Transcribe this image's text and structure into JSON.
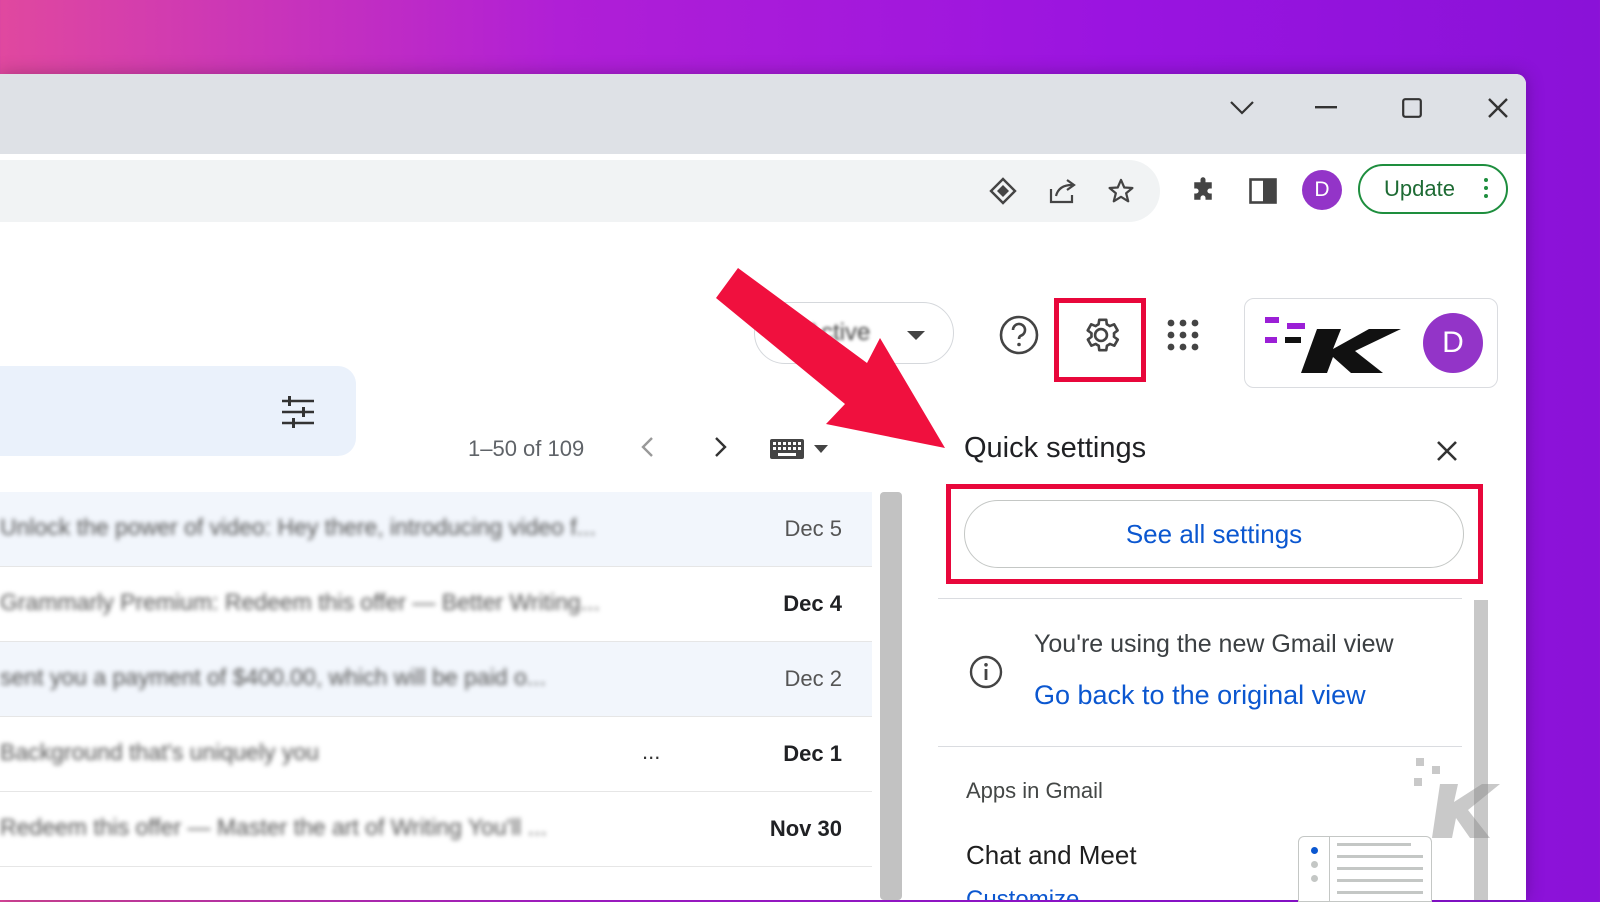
{
  "browser": {
    "profile_initial": "D",
    "update_label": "Update",
    "icons": [
      "caret-down-icon",
      "minimize-icon",
      "maximize-icon",
      "close-icon",
      "password-key-icon",
      "share-icon",
      "star-icon",
      "extensions-icon",
      "side-panel-icon"
    ]
  },
  "gmail": {
    "status_label": "Active",
    "account_initial": "D",
    "pagination": "1–50 of 109"
  },
  "emails": [
    {
      "subject": "Unlock the power of video: Hey there, introducing video f...",
      "date": "Dec 5",
      "unread": false,
      "ellipsis": ""
    },
    {
      "subject": "Grammarly Premium: Redeem this offer — Better Writing...",
      "date": "Dec 4",
      "unread": true,
      "ellipsis": ""
    },
    {
      "subject": "sent you a payment of $400.00, which will be paid o...",
      "date": "Dec 2",
      "unread": false,
      "ellipsis": ""
    },
    {
      "subject": "Background that's uniquely you",
      "date": "Dec 1",
      "unread": true,
      "ellipsis": "..."
    },
    {
      "subject": "Redeem this offer — Master the art of Writing You'll ...",
      "date": "Nov 30",
      "unread": true,
      "ellipsis": ""
    }
  ],
  "quick_settings": {
    "title": "Quick settings",
    "see_all": "See all settings",
    "notice": "You're using the new Gmail view",
    "back_link": "Go back to the original view",
    "apps_heading": "Apps in Gmail",
    "chat_meet": "Chat and Meet",
    "customize": "Customize"
  },
  "colors": {
    "highlight": "#e8073b",
    "accent_link": "#0b57d0",
    "update_green": "#1e8e3e",
    "avatar_purple": "#9334c8"
  }
}
